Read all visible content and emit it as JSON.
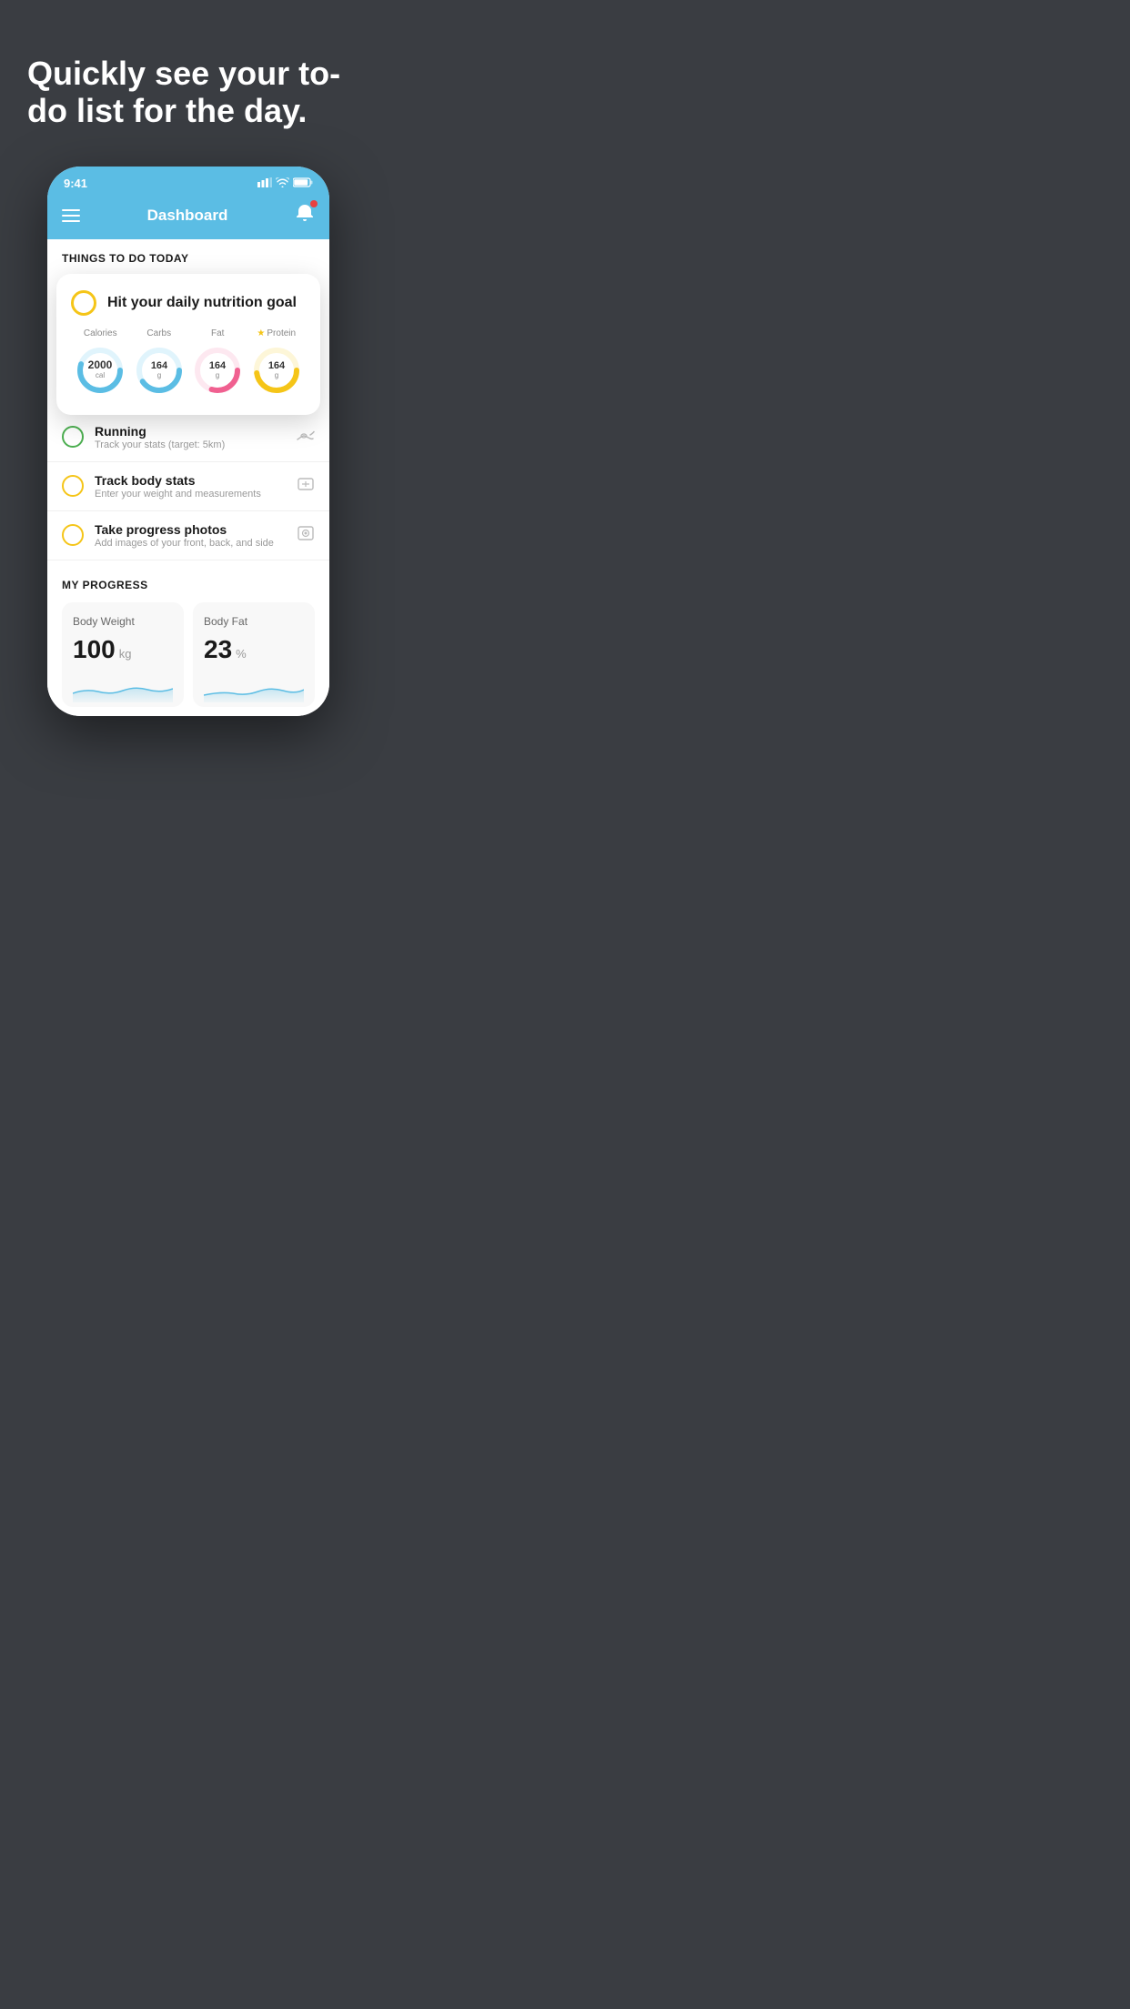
{
  "hero": {
    "title": "Quickly see your to-do list for the day."
  },
  "statusBar": {
    "time": "9:41",
    "signal": "▌▌▌",
    "wifi": "wifi",
    "battery": "battery"
  },
  "navBar": {
    "title": "Dashboard"
  },
  "thingsToDo": {
    "header": "THINGS TO DO TODAY",
    "nutrition": {
      "title": "Hit your daily nutrition goal",
      "items": [
        {
          "label": "Calories",
          "value": "2000",
          "unit": "cal",
          "color": "#5bbde4",
          "trackColor": "#e0f4fc"
        },
        {
          "label": "Carbs",
          "value": "164",
          "unit": "g",
          "color": "#5bbde4",
          "trackColor": "#e0f4fc"
        },
        {
          "label": "Fat",
          "value": "164",
          "unit": "g",
          "color": "#f06090",
          "trackColor": "#fde8f0"
        },
        {
          "label": "Protein",
          "value": "164",
          "unit": "g",
          "color": "#f5c518",
          "trackColor": "#fdf6d8",
          "starred": true
        }
      ]
    },
    "todos": [
      {
        "title": "Running",
        "subtitle": "Track your stats (target: 5km)",
        "circleColor": "green",
        "icon": "👟"
      },
      {
        "title": "Track body stats",
        "subtitle": "Enter your weight and measurements",
        "circleColor": "yellow",
        "icon": "⚖️"
      },
      {
        "title": "Take progress photos",
        "subtitle": "Add images of your front, back, and side",
        "circleColor": "yellow",
        "icon": "🖼️"
      }
    ]
  },
  "progress": {
    "header": "MY PROGRESS",
    "cards": [
      {
        "title": "Body Weight",
        "value": "100",
        "unit": "kg"
      },
      {
        "title": "Body Fat",
        "value": "23",
        "unit": "%"
      }
    ]
  }
}
